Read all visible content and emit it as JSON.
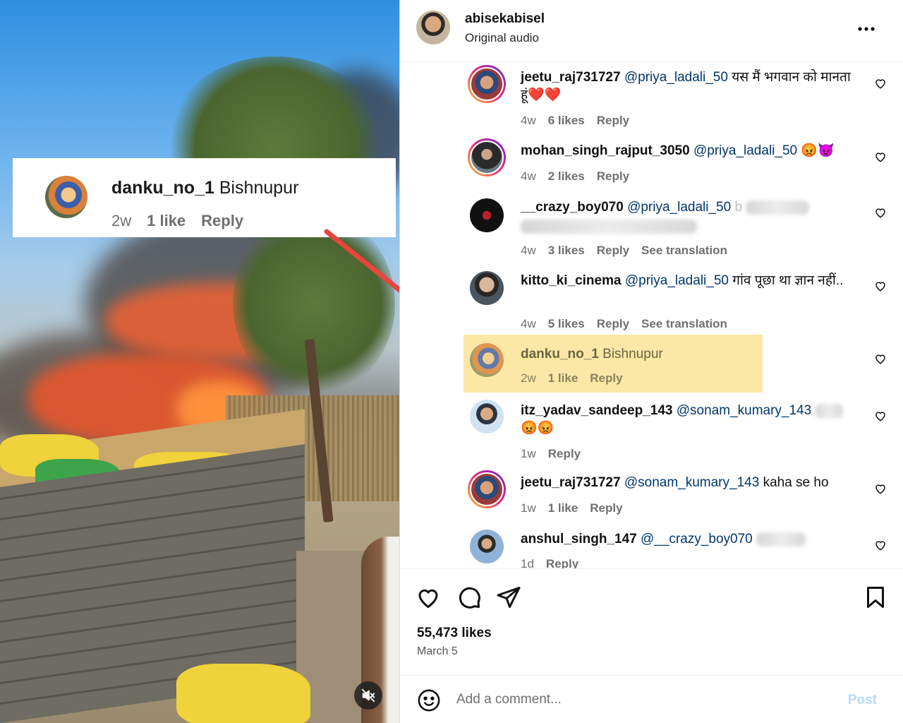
{
  "callout": {
    "username": "danku_no_1",
    "message": "Bishnupur",
    "age": "2w",
    "likes": "1 like",
    "reply": "Reply"
  },
  "post": {
    "author": "abisekabisel",
    "subtitle": "Original audio",
    "likes": "55,473 likes",
    "date": "March 5"
  },
  "comments": [
    {
      "user": "jeetu_raj731727",
      "mention": "@priya_ladali_50",
      "text": "यस मैं भगवान को मानता हूं❤️❤️",
      "age": "4w",
      "likes": "6 likes",
      "reply": "Reply"
    },
    {
      "user": "mohan_singh_rajput_3050",
      "mention": "@priya_ladali_50",
      "text": "😡😈",
      "age": "4w",
      "likes": "2 likes",
      "reply": "Reply"
    },
    {
      "user": "__crazy_boy070",
      "mention": "@priya_ladali_50",
      "text": "b",
      "age": "4w",
      "likes": "3 likes",
      "reply": "Reply",
      "translation": "See translation"
    },
    {
      "user": "kitto_ki_cinema",
      "mention": "@priya_ladali_50",
      "text": "गांव पूछा था ज्ञान नहीं..",
      "age": "4w",
      "likes": "5 likes",
      "reply": "Reply",
      "translation": "See translation"
    },
    {
      "user": "danku_no_1",
      "mention": "",
      "text": "Bishnupur",
      "age": "2w",
      "likes": "1 like",
      "reply": "Reply"
    },
    {
      "user": "itz_yadav_sandeep_143",
      "mention": "@sonam_kumary_143",
      "text": "😡😡",
      "age": "1w",
      "likes": "",
      "reply": "Reply"
    },
    {
      "user": "jeetu_raj731727",
      "mention": "@sonam_kumary_143",
      "text": "kaha se ho",
      "age": "1w",
      "likes": "1 like",
      "reply": "Reply"
    },
    {
      "user": "anshul_singh_147",
      "mention": "@__crazy_boy070",
      "text": "",
      "age": "1d",
      "likes": "",
      "reply": "Reply"
    }
  ],
  "composer": {
    "placeholder": "Add a comment...",
    "post_label": "Post"
  },
  "icons": {
    "more": "more-horizontal-icon",
    "like": "heart-icon",
    "comment": "comment-bubble-icon",
    "share": "paper-plane-icon",
    "save": "bookmark-icon",
    "emoji": "emoji-smile-icon",
    "mute": "muted-speaker-icon"
  },
  "colors": {
    "highlight": "#fbe8a6",
    "mention": "#00376b",
    "post_disabled": "#b8daf9",
    "arrow": "#e8453c"
  }
}
